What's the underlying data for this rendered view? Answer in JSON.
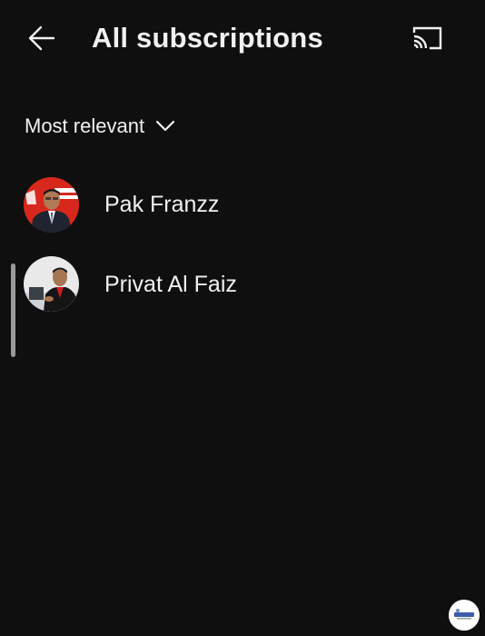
{
  "header": {
    "back_icon": "arrow-left-icon",
    "title": "All subscriptions",
    "cast_icon": "cast-icon"
  },
  "sort": {
    "label": "Most relevant",
    "icon": "chevron-down-icon"
  },
  "channels": [
    {
      "name": "Pak Franzz",
      "avatar": "avatar-pak-franzz"
    },
    {
      "name": "Privat Al Faiz",
      "avatar": "avatar-privat-al-faiz"
    }
  ],
  "colors": {
    "background": "#0f0f0f",
    "text": "#f1f1f1",
    "scrollbar": "#9a9a9a",
    "avatar1_bg": "#d8281e",
    "avatar2_bg": "#e9e9ea"
  }
}
